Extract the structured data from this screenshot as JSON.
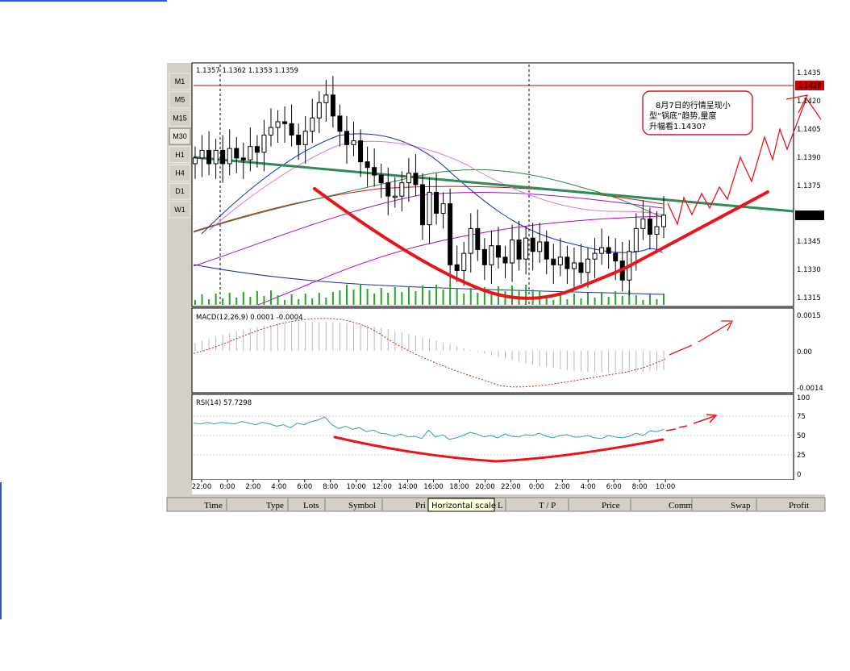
{
  "timeframes": [
    "M1",
    "M5",
    "M15",
    "M30",
    "H1",
    "H4",
    "D1",
    "W1"
  ],
  "active_timeframe": "M30",
  "ohlc_header": "1.1357 1.1362 1.1353 1.1359",
  "price_axis": [
    "1.1435",
    "1.1420",
    "1.1405",
    "1.1390",
    "1.1375",
    "1.1359",
    "1.1345",
    "1.1330",
    "1.1315"
  ],
  "resistance_label": "1.1428",
  "current_price_label": "1.1359",
  "annotation": [
    "8月7日的行情呈现小",
    "型“锅底”趋势,量度",
    "升幅看1.1430?"
  ],
  "macd": {
    "label": "MACD(12,26,9)  0.0001  -0.0004",
    "axis": [
      "0.0015",
      "0.00",
      "-0.0014"
    ]
  },
  "rsi": {
    "label": "RSI(14)  57.7298",
    "axis": [
      "100",
      "75",
      "50",
      "25",
      "0"
    ]
  },
  "time_axis": [
    "22:00",
    "0:00",
    "2:00",
    "4:00",
    "6:00",
    "8:00",
    "10:00",
    "12:00",
    "14:00",
    "16:00",
    "18:00",
    "20:00",
    "22:00",
    "0:00",
    "2:00",
    "4:00",
    "6:00",
    "8:00",
    "10:00"
  ],
  "columns": [
    "Time",
    "Type",
    "Lots",
    "Symbol",
    "Pri",
    "Horizontal scale",
    "L",
    "T / P",
    "Price",
    "Comm",
    "Swap",
    "Profit"
  ],
  "colors": {
    "resistance": "#cc0000",
    "trend_green": "#2e8b57",
    "hand_drawn": "#e8161b",
    "rsi_line": "#2aa6a6",
    "volume": "#22aa22"
  },
  "chart_data": {
    "type": "candlestick",
    "title": "",
    "x_ticks": [
      "22:00",
      "0:00",
      "2:00",
      "4:00",
      "6:00",
      "8:00",
      "10:00",
      "12:00",
      "14:00",
      "16:00",
      "18:00",
      "20:00",
      "22:00",
      "0:00",
      "2:00",
      "4:00",
      "6:00",
      "8:00",
      "10:00"
    ],
    "ylim": [
      1.1312,
      1.1438
    ],
    "y_ticks": [
      1.1435,
      1.142,
      1.1405,
      1.139,
      1.1375,
      1.1359,
      1.1345,
      1.133,
      1.1315
    ],
    "resistance_level": 1.1428,
    "last_price": 1.1359,
    "close": [
      1.1389,
      1.1393,
      1.1386,
      1.1393,
      1.1386,
      1.1394,
      1.1389,
      1.1388,
      1.1395,
      1.1392,
      1.1401,
      1.1405,
      1.1408,
      1.1407,
      1.1401,
      1.1396,
      1.1403,
      1.141,
      1.1418,
      1.1422,
      1.1411,
      1.1403,
      1.1396,
      1.1398,
      1.1387,
      1.1384,
      1.138,
      1.1376,
      1.1369,
      1.1369,
      1.1376,
      1.1381,
      1.1375,
      1.1354,
      1.1371,
      1.136,
      1.1365,
      1.1333,
      1.133,
      1.1339,
      1.1352,
      1.1341,
      1.1333,
      1.1343,
      1.1337,
      1.1334,
      1.1346,
      1.1336,
      1.1347,
      1.134,
      1.1345,
      1.1336,
      1.1333,
      1.1337,
      1.1331,
      1.1334,
      1.1329,
      1.1336,
      1.1339,
      1.1342,
      1.1339,
      1.1335,
      1.1325,
      1.134,
      1.1352,
      1.1357,
      1.1349,
      1.1353,
      1.1359
    ],
    "macd_ylim": [
      -0.0014,
      0.0015
    ],
    "rsi_ylim": [
      0,
      100
    ],
    "rsi": [
      66,
      65,
      67,
      65,
      67,
      66,
      65,
      68,
      66,
      64,
      67,
      65,
      62,
      64,
      60,
      66,
      64,
      68,
      70,
      74,
      64,
      59,
      62,
      58,
      60,
      55,
      57,
      53,
      52,
      49,
      52,
      48,
      49,
      46,
      57,
      48,
      51,
      45,
      47,
      50,
      54,
      52,
      48,
      50,
      47,
      52,
      49,
      48,
      51,
      50,
      53,
      49,
      47,
      50,
      51,
      48,
      48,
      50,
      47,
      46,
      50,
      48,
      47,
      49,
      53,
      50,
      56,
      55,
      58
    ]
  }
}
